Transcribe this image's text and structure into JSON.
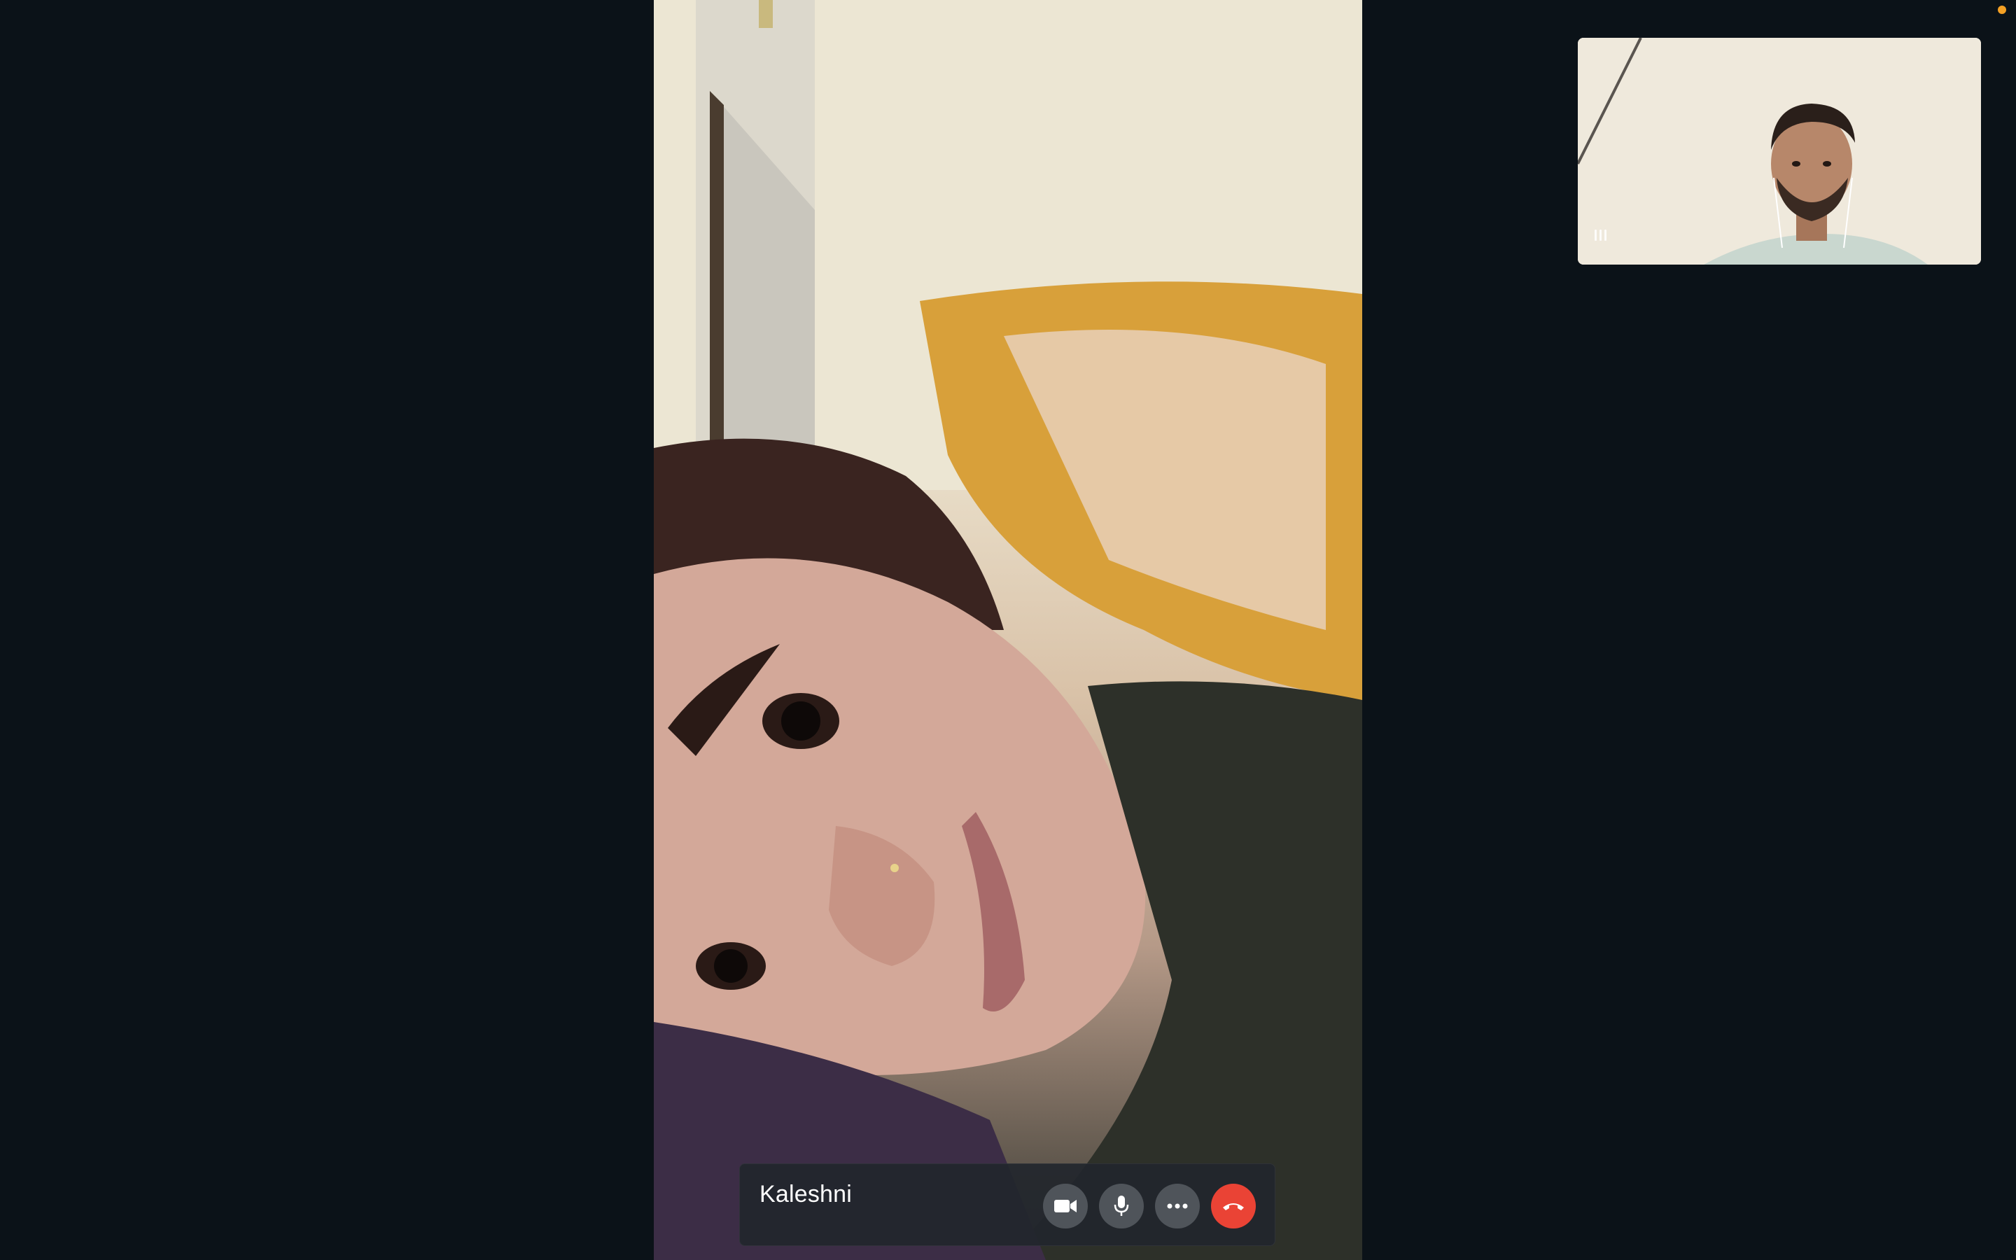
{
  "call": {
    "participant_name": "Kaleshni"
  },
  "controls": {
    "camera_icon": "video-camera-icon",
    "mic_icon": "microphone-icon",
    "more_icon": "more-options-icon",
    "end_icon": "end-call-icon"
  },
  "colors": {
    "background": "#0b1218",
    "control_bar": "#22262c",
    "button": "#4f545a",
    "end_call": "#ea4335",
    "status_dot": "#f4a024"
  }
}
